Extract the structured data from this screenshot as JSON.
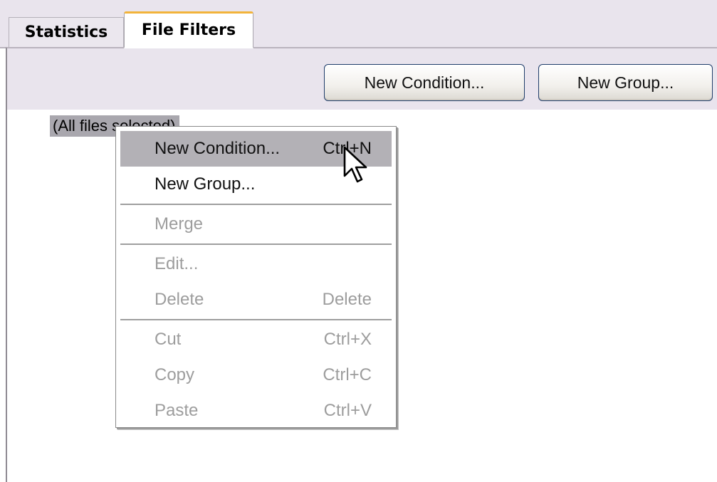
{
  "tabs": [
    {
      "label": "Statistics",
      "active": false
    },
    {
      "label": "File Filters",
      "active": true
    }
  ],
  "toolbar": {
    "new_condition_label": "New Condition...",
    "new_group_label": "New Group..."
  },
  "tree": {
    "root_label": "(All files selected)"
  },
  "context_menu": {
    "items": [
      {
        "label": "New Condition...",
        "shortcut": "Ctrl+N",
        "enabled": true,
        "highlighted": true
      },
      {
        "label": "New Group...",
        "shortcut": "",
        "enabled": true
      },
      {
        "label": "Merge",
        "shortcut": "",
        "enabled": false
      },
      {
        "label": "Edit...",
        "shortcut": "",
        "enabled": false
      },
      {
        "label": "Delete",
        "shortcut": "Delete",
        "enabled": false
      },
      {
        "label": "Cut",
        "shortcut": "Ctrl+X",
        "enabled": false
      },
      {
        "label": "Copy",
        "shortcut": "Ctrl+C",
        "enabled": false
      },
      {
        "label": "Paste",
        "shortcut": "Ctrl+V",
        "enabled": false
      }
    ]
  },
  "colors": {
    "active_tab_accent": "#f2b33a",
    "toolbar_bg": "#e9e4ed",
    "selection_bg": "#a9a7ae",
    "menu_highlight": "#b3b1b6",
    "disabled_text": "#9d9d9d"
  },
  "icons": {
    "cursor": "arrow-cursor-icon"
  }
}
